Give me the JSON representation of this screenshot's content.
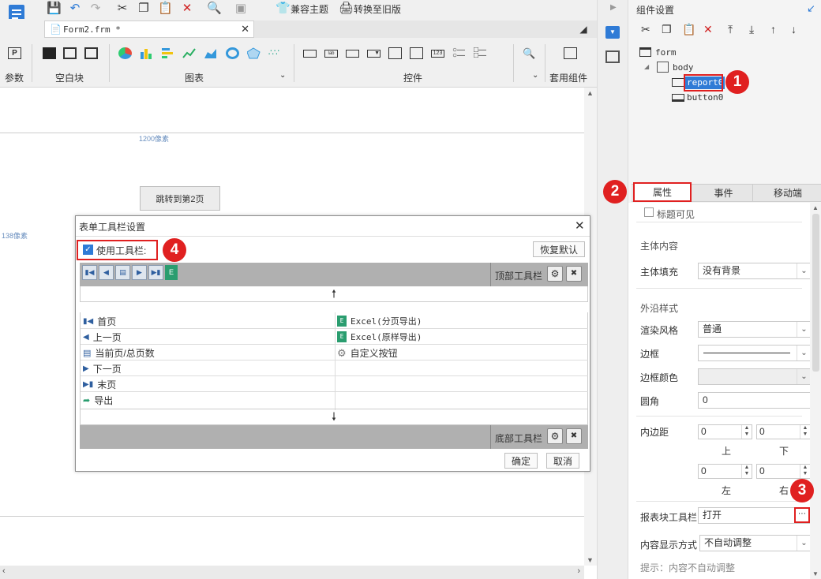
{
  "toolbar": {
    "compat_theme": "兼容主题",
    "switch_old": "转换至旧版"
  },
  "tab": {
    "label": "Form2.frm *"
  },
  "ribbon": {
    "param": "参数",
    "blank": "空白块",
    "chart": "图表",
    "control": "控件",
    "template": "套用组件"
  },
  "canvas": {
    "width_label": "1200像素",
    "left_label": "138像素",
    "jump_button": "跳转到第2页"
  },
  "dialog": {
    "title": "表单工具栏设置",
    "use_toolbar": "使用工具栏:",
    "restore_default": "恢复默认",
    "top_toolbar": "顶部工具栏",
    "bottom_toolbar": "底部工具栏",
    "left_items": [
      "首页",
      "上一页",
      "当前页/总页数",
      "下一页",
      "末页",
      "导出"
    ],
    "right_items": [
      "Excel(分页导出)",
      "Excel(原样导出)",
      "自定义按钮"
    ],
    "ok": "确定",
    "cancel": "取消"
  },
  "panel": {
    "title": "组件设置",
    "tree": {
      "form": "form",
      "body": "body",
      "report": "report0",
      "button": "button0"
    },
    "tabs": [
      "属性",
      "事件",
      "移动端"
    ],
    "title_visible": "标题可见",
    "section_main": "主体内容",
    "fill_label": "主体填充",
    "fill_value": "没有背景",
    "section_outer": "外沿样式",
    "render_label": "渲染风格",
    "render_value": "普通",
    "border_label": "边框",
    "border_color_label": "边框颜色",
    "radius_label": "圆角",
    "radius_value": "0",
    "padding_label": "内边距",
    "pad_top": "0",
    "pad_bottom": "0",
    "pad_left": "0",
    "pad_right": "0",
    "top": "上",
    "bottom": "下",
    "left": "左",
    "right": "右",
    "toolbar_label": "报表块工具栏",
    "toolbar_value": "打开",
    "display_label": "内容显示方式",
    "display_value": "不自动调整",
    "hint": "提示：内容不自动调整"
  },
  "badges": [
    "1",
    "2",
    "3",
    "4"
  ],
  "colors": {
    "accent": "#2f7bd6",
    "badge": "#e02020",
    "toolbar_gray": "#b0b0b0",
    "selected": "#2f7bd6"
  }
}
